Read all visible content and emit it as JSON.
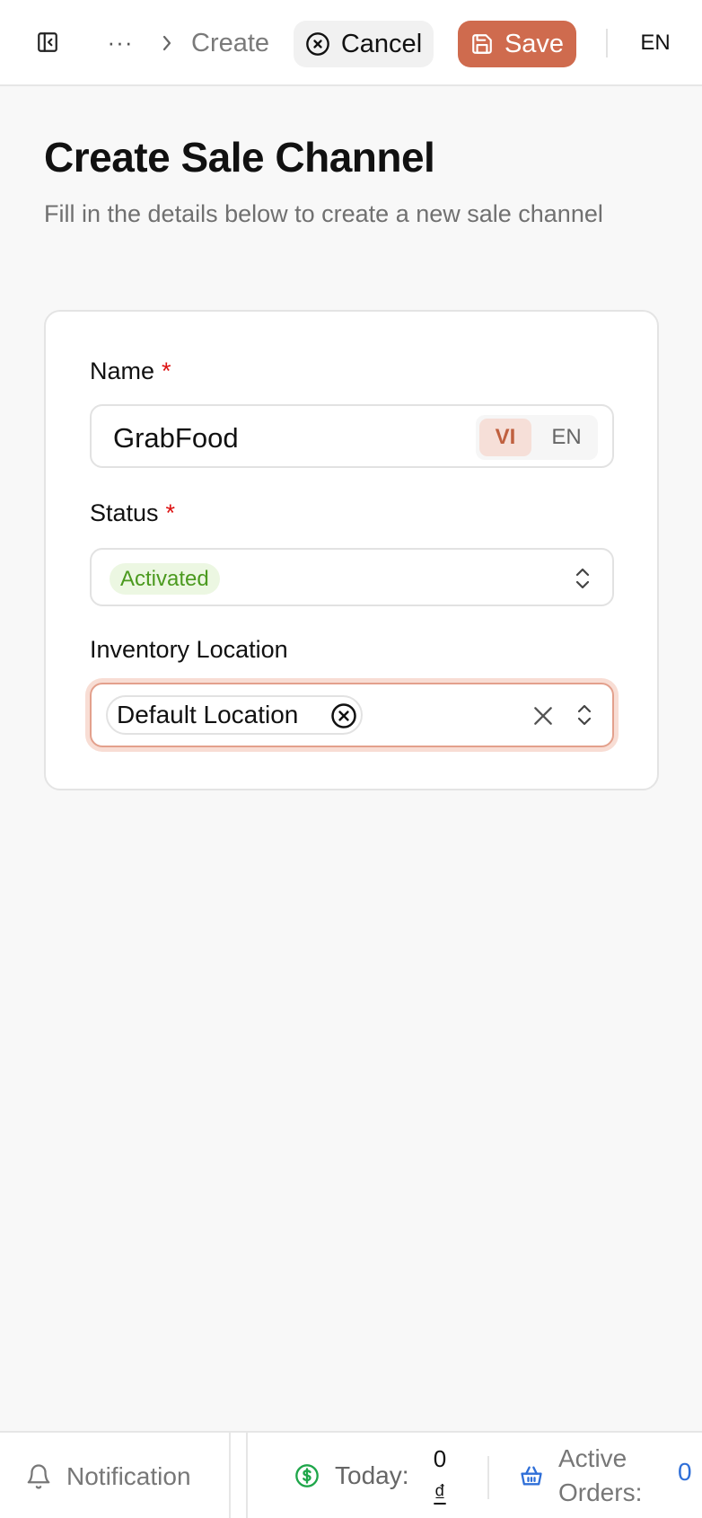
{
  "header": {
    "more_label": "···",
    "breadcrumb_current": "Create",
    "cancel_label": "Cancel",
    "save_label": "Save",
    "language": "EN"
  },
  "page": {
    "title": "Create Sale Channel",
    "subtitle": "Fill in the details below to create a new sale channel"
  },
  "form": {
    "name": {
      "label": "Name",
      "required_mark": "*",
      "value": "GrabFood",
      "lang_options": [
        "VI",
        "EN"
      ],
      "active_lang": "VI"
    },
    "status": {
      "label": "Status",
      "required_mark": "*",
      "value": "Activated"
    },
    "inventory_location": {
      "label": "Inventory Location",
      "selected": [
        "Default Location"
      ]
    }
  },
  "footer": {
    "notification_label": "Notification",
    "today_label": "Today:",
    "today_value": "0",
    "today_currency": "₫",
    "active_orders_label": "Active Orders:",
    "active_orders_value": "0"
  },
  "colors": {
    "brand": "#cf6b4e",
    "status_active_text": "#4b9a1f",
    "status_active_bg": "#ecf7e2",
    "required": "#dd1111",
    "link_blue": "#2f6fd8"
  }
}
